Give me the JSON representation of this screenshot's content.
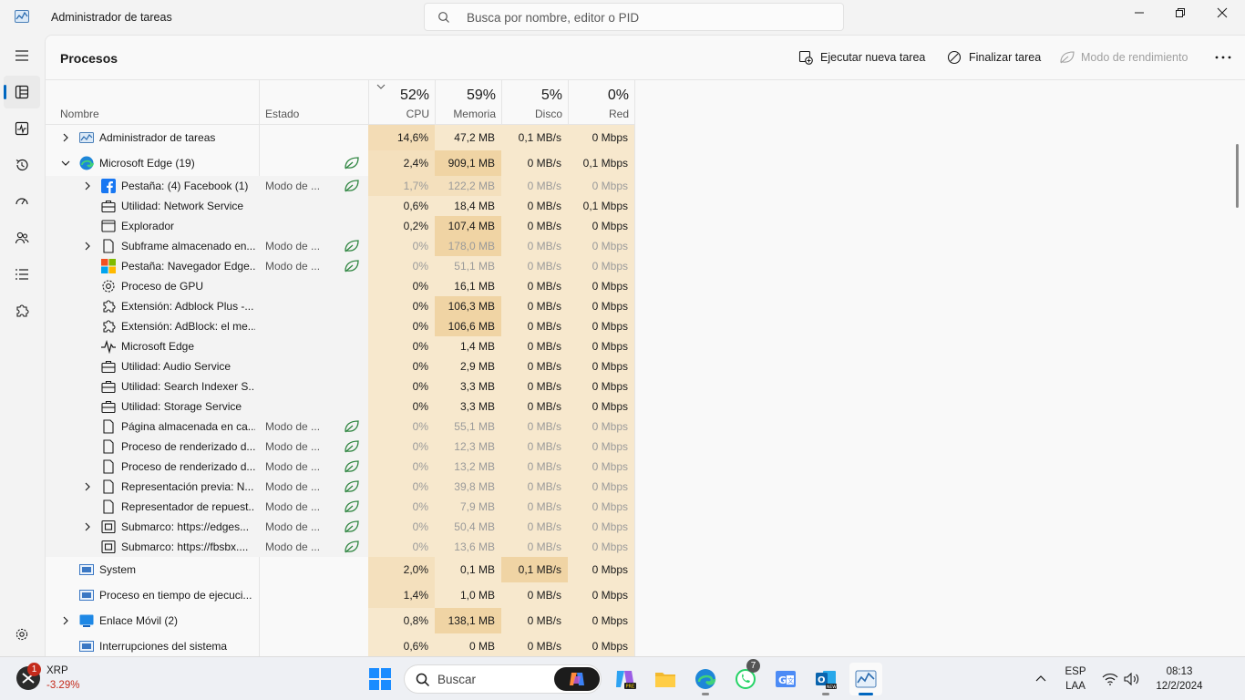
{
  "app": {
    "title": "Administrador de tareas"
  },
  "search": {
    "placeholder": "Busca por nombre, editor o PID"
  },
  "nav": {
    "items": [
      "menu",
      "procesos",
      "rendimiento",
      "historial",
      "inicio",
      "usuarios",
      "detalles",
      "servicios",
      "configuracion"
    ],
    "active": "procesos"
  },
  "toolbar": {
    "page_title": "Procesos",
    "run_task": "Ejecutar nueva tarea",
    "end_task": "Finalizar tarea",
    "efficiency_mode": "Modo de rendimiento"
  },
  "columns": {
    "name": "Nombre",
    "status": "Estado",
    "cpu": {
      "pct": "52%",
      "label": "CPU"
    },
    "memory": {
      "pct": "59%",
      "label": "Memoria"
    },
    "disk": {
      "pct": "5%",
      "label": "Disco"
    },
    "network": {
      "pct": "0%",
      "label": "Red"
    }
  },
  "processes": [
    {
      "name": "Administrador de tareas",
      "status": "",
      "cpu": "14,6%",
      "mem": "47,2 MB",
      "disk": "0,1 MB/s",
      "net": "0 Mbps",
      "level": 0,
      "chevron": "right",
      "icon": "taskmgr-icon",
      "leaf": false,
      "dim": false,
      "heat": [
        "#f3dcb5",
        "#f7e8cd",
        "#f7e8cd",
        "#f7e8cd"
      ]
    },
    {
      "name": "Microsoft Edge (19)",
      "status": "",
      "cpu": "2,4%",
      "mem": "909,1 MB",
      "disk": "0 MB/s",
      "net": "0,1 Mbps",
      "level": 0,
      "chevron": "down",
      "icon": "edge-icon",
      "leaf": true,
      "dim": false,
      "heat": [
        "#f4e0bd",
        "#f0d4a4",
        "#f7e8cd",
        "#f7e8cd"
      ]
    },
    {
      "name": "Pestaña: (4) Facebook (1)",
      "status": "Modo de ...",
      "cpu": "1,7%",
      "mem": "122,2 MB",
      "disk": "0 MB/s",
      "net": "0 Mbps",
      "level": 1,
      "chevron": "right",
      "icon": "facebook-icon",
      "leaf": true,
      "dim": true,
      "heat": [
        "#f4e0bd",
        "#f4e0bd",
        "#f7e8cd",
        "#f7e8cd"
      ]
    },
    {
      "name": "Utilidad: Network Service",
      "status": "",
      "cpu": "0,6%",
      "mem": "18,4 MB",
      "disk": "0 MB/s",
      "net": "0,1 Mbps",
      "level": 1,
      "chevron": "",
      "icon": "briefcase-icon",
      "leaf": false,
      "dim": false,
      "heat": [
        "#f7e8cd",
        "#f7e8cd",
        "#f7e8cd",
        "#f7e8cd"
      ]
    },
    {
      "name": "Explorador",
      "status": "",
      "cpu": "0,2%",
      "mem": "107,4 MB",
      "disk": "0 MB/s",
      "net": "0 Mbps",
      "level": 1,
      "chevron": "",
      "icon": "window-icon",
      "leaf": false,
      "dim": false,
      "heat": [
        "#f7e8cd",
        "#f0d4a4",
        "#f7e8cd",
        "#f7e8cd"
      ]
    },
    {
      "name": "Subframe almacenado en...",
      "status": "Modo de ...",
      "cpu": "0%",
      "mem": "178,0 MB",
      "disk": "0 MB/s",
      "net": "0 Mbps",
      "level": 1,
      "chevron": "right",
      "icon": "page-icon",
      "leaf": true,
      "dim": true,
      "heat": [
        "#f7e8cd",
        "#f0d4a4",
        "#f7e8cd",
        "#f7e8cd"
      ]
    },
    {
      "name": "Pestaña: Navegador Edge...",
      "status": "Modo de ...",
      "cpu": "0%",
      "mem": "51,1 MB",
      "disk": "0 MB/s",
      "net": "0 Mbps",
      "level": 1,
      "chevron": "",
      "icon": "microsoft-icon",
      "leaf": true,
      "dim": true,
      "heat": [
        "#f7e8cd",
        "#f7e8cd",
        "#f7e8cd",
        "#f7e8cd"
      ]
    },
    {
      "name": "Proceso de GPU",
      "status": "",
      "cpu": "0%",
      "mem": "16,1 MB",
      "disk": "0 MB/s",
      "net": "0 Mbps",
      "level": 1,
      "chevron": "",
      "icon": "gear-icon",
      "leaf": false,
      "dim": false,
      "heat": [
        "#f7e8cd",
        "#f7e8cd",
        "#f7e8cd",
        "#f7e8cd"
      ]
    },
    {
      "name": "Extensión: Adblock Plus -...",
      "status": "",
      "cpu": "0%",
      "mem": "106,3 MB",
      "disk": "0 MB/s",
      "net": "0 Mbps",
      "level": 1,
      "chevron": "",
      "icon": "puzzle-icon",
      "leaf": false,
      "dim": false,
      "heat": [
        "#f7e8cd",
        "#f0d4a4",
        "#f7e8cd",
        "#f7e8cd"
      ]
    },
    {
      "name": "Extensión: AdBlock: el me...",
      "status": "",
      "cpu": "0%",
      "mem": "106,6 MB",
      "disk": "0 MB/s",
      "net": "0 Mbps",
      "level": 1,
      "chevron": "",
      "icon": "puzzle-icon",
      "leaf": false,
      "dim": false,
      "heat": [
        "#f7e8cd",
        "#f0d4a4",
        "#f7e8cd",
        "#f7e8cd"
      ]
    },
    {
      "name": "Microsoft Edge",
      "status": "",
      "cpu": "0%",
      "mem": "1,4 MB",
      "disk": "0 MB/s",
      "net": "0 Mbps",
      "level": 1,
      "chevron": "",
      "icon": "pulse-icon",
      "leaf": false,
      "dim": false,
      "heat": [
        "#f7e8cd",
        "#f7e8cd",
        "#f7e8cd",
        "#f7e8cd"
      ]
    },
    {
      "name": "Utilidad: Audio Service",
      "status": "",
      "cpu": "0%",
      "mem": "2,9 MB",
      "disk": "0 MB/s",
      "net": "0 Mbps",
      "level": 1,
      "chevron": "",
      "icon": "briefcase-icon",
      "leaf": false,
      "dim": false,
      "heat": [
        "#f7e8cd",
        "#f7e8cd",
        "#f7e8cd",
        "#f7e8cd"
      ]
    },
    {
      "name": "Utilidad: Search Indexer S...",
      "status": "",
      "cpu": "0%",
      "mem": "3,3 MB",
      "disk": "0 MB/s",
      "net": "0 Mbps",
      "level": 1,
      "chevron": "",
      "icon": "briefcase-icon",
      "leaf": false,
      "dim": false,
      "heat": [
        "#f7e8cd",
        "#f7e8cd",
        "#f7e8cd",
        "#f7e8cd"
      ]
    },
    {
      "name": "Utilidad: Storage Service",
      "status": "",
      "cpu": "0%",
      "mem": "3,3 MB",
      "disk": "0 MB/s",
      "net": "0 Mbps",
      "level": 1,
      "chevron": "",
      "icon": "briefcase-icon",
      "leaf": false,
      "dim": false,
      "heat": [
        "#f7e8cd",
        "#f7e8cd",
        "#f7e8cd",
        "#f7e8cd"
      ]
    },
    {
      "name": "Página almacenada en ca...",
      "status": "Modo de ...",
      "cpu": "0%",
      "mem": "55,1 MB",
      "disk": "0 MB/s",
      "net": "0 Mbps",
      "level": 1,
      "chevron": "",
      "icon": "page-icon",
      "leaf": true,
      "dim": true,
      "heat": [
        "#f7e8cd",
        "#f7e8cd",
        "#f7e8cd",
        "#f7e8cd"
      ]
    },
    {
      "name": "Proceso de renderizado d...",
      "status": "Modo de ...",
      "cpu": "0%",
      "mem": "12,3 MB",
      "disk": "0 MB/s",
      "net": "0 Mbps",
      "level": 1,
      "chevron": "",
      "icon": "page-icon",
      "leaf": true,
      "dim": true,
      "heat": [
        "#f7e8cd",
        "#f7e8cd",
        "#f7e8cd",
        "#f7e8cd"
      ]
    },
    {
      "name": "Proceso de renderizado d...",
      "status": "Modo de ...",
      "cpu": "0%",
      "mem": "13,2 MB",
      "disk": "0 MB/s",
      "net": "0 Mbps",
      "level": 1,
      "chevron": "",
      "icon": "page-icon",
      "leaf": true,
      "dim": true,
      "heat": [
        "#f7e8cd",
        "#f7e8cd",
        "#f7e8cd",
        "#f7e8cd"
      ]
    },
    {
      "name": "Representación previa: N...",
      "status": "Modo de ...",
      "cpu": "0%",
      "mem": "39,8 MB",
      "disk": "0 MB/s",
      "net": "0 Mbps",
      "level": 1,
      "chevron": "right",
      "icon": "page-icon",
      "leaf": true,
      "dim": true,
      "heat": [
        "#f7e8cd",
        "#f7e8cd",
        "#f7e8cd",
        "#f7e8cd"
      ]
    },
    {
      "name": "Representador de repuest...",
      "status": "Modo de ...",
      "cpu": "0%",
      "mem": "7,9 MB",
      "disk": "0 MB/s",
      "net": "0 Mbps",
      "level": 1,
      "chevron": "",
      "icon": "page-icon",
      "leaf": true,
      "dim": true,
      "heat": [
        "#f7e8cd",
        "#f7e8cd",
        "#f7e8cd",
        "#f7e8cd"
      ]
    },
    {
      "name": "Submarco: https://edges...",
      "status": "Modo de ...",
      "cpu": "0%",
      "mem": "50,4 MB",
      "disk": "0 MB/s",
      "net": "0 Mbps",
      "level": 1,
      "chevron": "right",
      "icon": "frame-icon",
      "leaf": true,
      "dim": true,
      "heat": [
        "#f7e8cd",
        "#f7e8cd",
        "#f7e8cd",
        "#f7e8cd"
      ]
    },
    {
      "name": "Submarco: https://fbsbx....",
      "status": "Modo de ...",
      "cpu": "0%",
      "mem": "13,6 MB",
      "disk": "0 MB/s",
      "net": "0 Mbps",
      "level": 1,
      "chevron": "",
      "icon": "frame-icon",
      "leaf": true,
      "dim": true,
      "heat": [
        "#f7e8cd",
        "#f7e8cd",
        "#f7e8cd",
        "#f7e8cd"
      ]
    },
    {
      "name": "System",
      "status": "",
      "cpu": "2,0%",
      "mem": "0,1 MB",
      "disk": "0,1 MB/s",
      "net": "0 Mbps",
      "level": 0,
      "chevron": "",
      "icon": "system-icon",
      "leaf": false,
      "dim": false,
      "heat": [
        "#f4e0bd",
        "#f7e8cd",
        "#f0d4a4",
        "#f7e8cd"
      ]
    },
    {
      "name": "Proceso en tiempo de ejecuci...",
      "status": "",
      "cpu": "1,4%",
      "mem": "1,0 MB",
      "disk": "0 MB/s",
      "net": "0 Mbps",
      "level": 0,
      "chevron": "",
      "icon": "system-icon",
      "leaf": false,
      "dim": false,
      "heat": [
        "#f4e0bd",
        "#f7e8cd",
        "#f7e8cd",
        "#f7e8cd"
      ]
    },
    {
      "name": "Enlace Móvil (2)",
      "status": "",
      "cpu": "0,8%",
      "mem": "138,1 MB",
      "disk": "0 MB/s",
      "net": "0 Mbps",
      "level": 0,
      "chevron": "right",
      "icon": "phone-link-icon",
      "leaf": false,
      "dim": false,
      "heat": [
        "#f7e8cd",
        "#f0d4a4",
        "#f7e8cd",
        "#f7e8cd"
      ]
    },
    {
      "name": "Interrupciones del sistema",
      "status": "",
      "cpu": "0,6%",
      "mem": "0 MB",
      "disk": "0 MB/s",
      "net": "0 Mbps",
      "level": 0,
      "chevron": "",
      "icon": "system-icon",
      "leaf": false,
      "dim": false,
      "heat": [
        "#f7e8cd",
        "#f7e8cd",
        "#f7e8cd",
        "#f7e8cd"
      ]
    }
  ],
  "taskbar": {
    "widget_name": "XRP",
    "widget_value": "-3.29%",
    "widget_badge": "1",
    "search_label": "Buscar",
    "whatsapp_badge": "7",
    "lang_top": "ESP",
    "lang_bottom": "LAA",
    "time": "08:13",
    "date": "12/2/2024"
  },
  "colors": {
    "accent": "#0067c0",
    "heat_low": "#f7e8cd",
    "heat_mid": "#f4e0bd",
    "heat_high": "#f0d4a4",
    "leaf_green": "#2e8540"
  }
}
